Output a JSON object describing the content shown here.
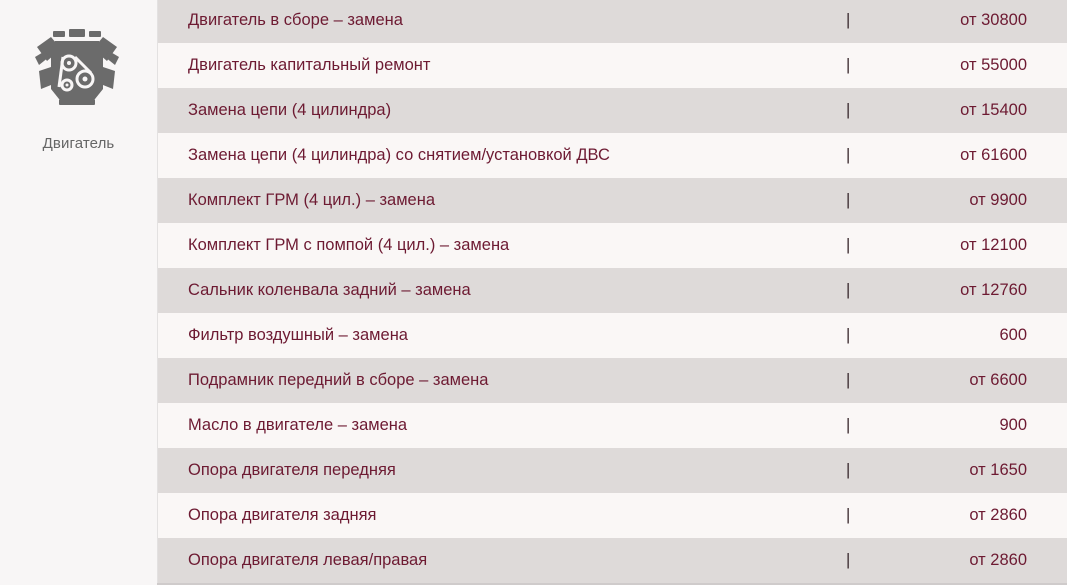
{
  "category": {
    "label": "Двигатель",
    "icon": "engine-icon"
  },
  "separator": "|",
  "colors": {
    "row_dark": "#dedad9",
    "row_light": "#faf7f6",
    "text": "#6d1a32",
    "icon": "#666666"
  },
  "services": [
    {
      "name": "Двигатель в сборе – замена",
      "price": "от 30800"
    },
    {
      "name": "Двигатель капитальный ремонт",
      "price": "от 55000"
    },
    {
      "name": "Замена цепи (4 цилиндра)",
      "price": "от 15400"
    },
    {
      "name": "Замена цепи (4 цилиндра) со снятием/установкой ДВС",
      "price": "от 61600"
    },
    {
      "name": "Комплект ГРМ (4 цил.) – замена",
      "price": "от 9900"
    },
    {
      "name": "Комплект ГРМ с помпой (4 цил.) – замена",
      "price": "от 12100"
    },
    {
      "name": "Сальник коленвала задний – замена",
      "price": "от 12760"
    },
    {
      "name": "Фильтр воздушный – замена",
      "price": "600"
    },
    {
      "name": "Подрамник передний в сборе – замена",
      "price": "от 6600"
    },
    {
      "name": "Масло в двигателе – замена",
      "price": "900"
    },
    {
      "name": "Опора двигателя передняя",
      "price": "от 1650"
    },
    {
      "name": "Опора двигателя задняя",
      "price": "от 2860"
    },
    {
      "name": "Опора двигателя левая/правая",
      "price": "от 2860"
    }
  ]
}
